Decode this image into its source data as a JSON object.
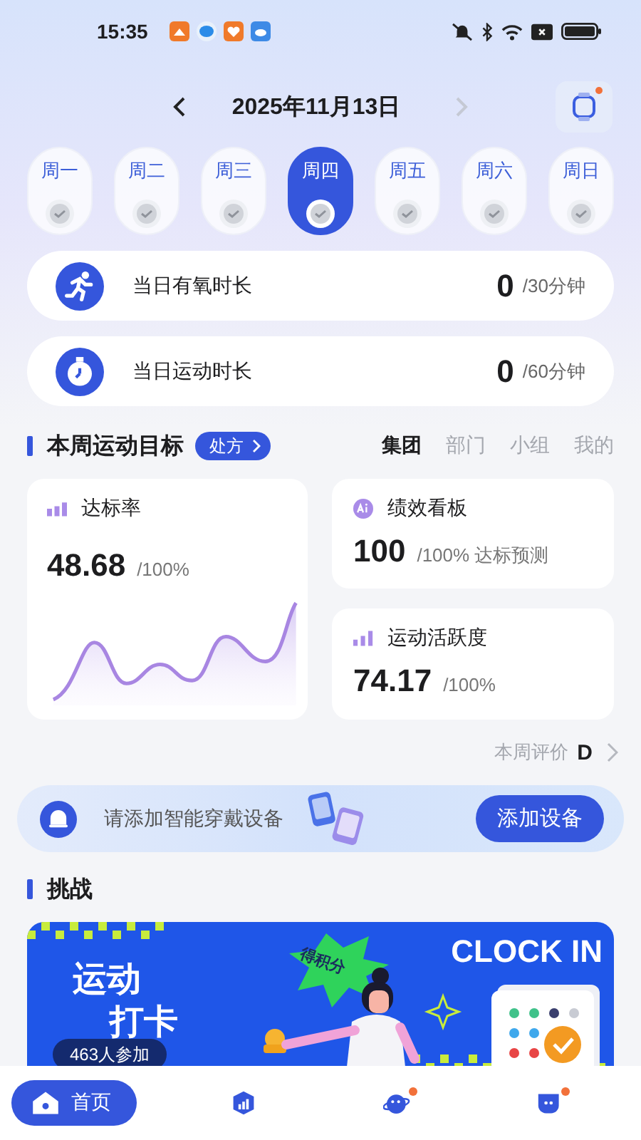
{
  "status_bar": {
    "time": "15:35"
  },
  "header": {
    "date": "2025年11月13日",
    "next_disabled": true,
    "watch_badge": true
  },
  "days": [
    {
      "label": "周一",
      "selected": false
    },
    {
      "label": "周二",
      "selected": false
    },
    {
      "label": "周三",
      "selected": false
    },
    {
      "label": "周四",
      "selected": true
    },
    {
      "label": "周五",
      "selected": false
    },
    {
      "label": "周六",
      "selected": false
    },
    {
      "label": "周日",
      "selected": false
    }
  ],
  "daily_stats": [
    {
      "kind": "run",
      "label": "当日有氧时长",
      "value": "0",
      "target": "/30分钟"
    },
    {
      "kind": "timer",
      "label": "当日运动时长",
      "value": "0",
      "target": "/60分钟"
    }
  ],
  "goals": {
    "title": "本周运动目标",
    "prescription_button": "处方",
    "tabs": [
      {
        "label": "集团",
        "selected": true
      },
      {
        "label": "部门",
        "selected": false
      },
      {
        "label": "小组",
        "selected": false
      },
      {
        "label": "我的",
        "selected": false
      }
    ]
  },
  "cards": [
    {
      "kind": "chart",
      "title": "达标率",
      "value": "48.68",
      "unit": "/100%"
    },
    {
      "kind": "ai",
      "title": "绩效看板",
      "value": "100",
      "unit": "/100% 达标预测"
    },
    {
      "kind": "bars",
      "title": "运动活跃度",
      "value": "74.17",
      "unit": "/100%"
    }
  ],
  "weekly_rating": {
    "label": "本周评价",
    "grade": "D"
  },
  "device_banner": {
    "message": "请添加智能穿戴设备",
    "button": "添加设备"
  },
  "challenge": {
    "title": "挑战",
    "banner": {
      "title_lines": [
        "运动",
        "打卡"
      ],
      "sticker": "得积分",
      "headline": "CLOCK IN",
      "participants": "463人参加"
    }
  },
  "nav": [
    {
      "kind": "home",
      "label": "首页",
      "selected": true,
      "badge": false
    },
    {
      "kind": "stats",
      "selected": false,
      "badge": false
    },
    {
      "kind": "planet",
      "selected": false,
      "badge": true
    },
    {
      "kind": "chat",
      "selected": false,
      "badge": true
    }
  ]
}
